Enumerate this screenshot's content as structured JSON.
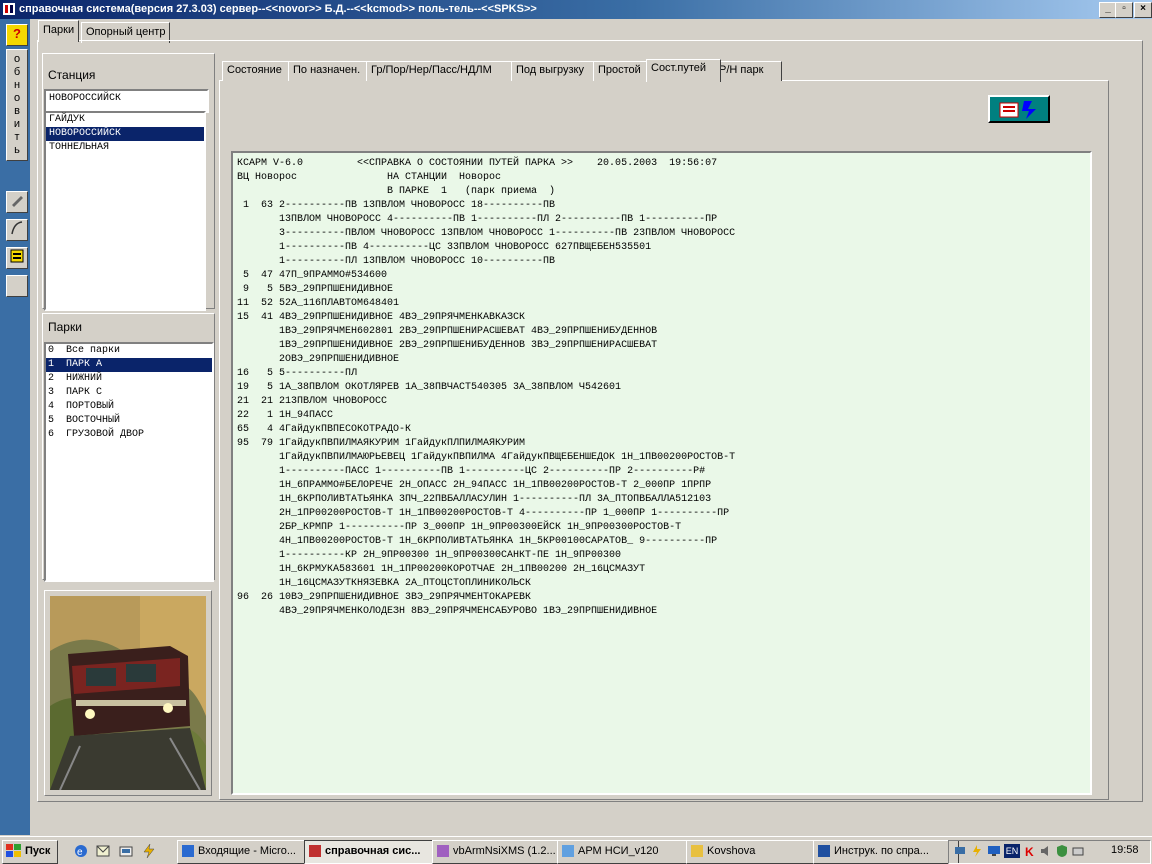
{
  "window": {
    "title": "справочная система(версия 27.3.03) сервер--<<novor>> Б.Д.--<<kcmod>> поль-тель--<<SPKS>>",
    "minimize": "_",
    "maximize": "▫",
    "close": "×"
  },
  "toolbar": {
    "help_label": "?",
    "refresh_letters": [
      "о",
      "б",
      "н",
      "о",
      "в",
      "и",
      "т",
      "ь"
    ]
  },
  "outer_tabs": [
    "Парки",
    "Опорный центр"
  ],
  "left": {
    "station_label": "Станция",
    "station_value": "НОВОРОССИЙСК",
    "stations": [
      "ГАЙДУК",
      "НОВОРОССИЙСК",
      "ТОННЕЛЬНАЯ"
    ],
    "stations_selected": 1,
    "parks_label": "Парки",
    "parks": [
      "0  Все парки",
      "1  ПАРК А",
      "2  НИЖНИЙ",
      "3  ПАРК С",
      "4  ПОРТОВЫЙ",
      "5  ВОСТОЧНЫЙ",
      "6  ГРУЗОВОЙ ДВОР"
    ],
    "parks_selected": 1
  },
  "inner_tabs": [
    "Состояние",
    "По назначен.",
    "Гр/Пор/Нер/Пасс/НДЛМ",
    "Под выгрузку",
    "Простой",
    "Сост.путей",
    "Р/Н парк"
  ],
  "inner_tab_active": 5,
  "report_lines": [
    "КСАРМ V-6.0         <<СПРАВКА О СОСТОЯНИИ ПУТЕЙ ПАРКА >>    20.05.2003  19:56:07",
    "ВЦ Новорос               НА СТАНЦИИ  Новорос",
    "                         В ПАРКЕ  1   (парк приема  )",
    " 1  63 2----------ПВ 13ПВЛОМ ЧНОВОРОСС 18----------ПВ",
    "       13ПВЛОМ ЧНОВОРОСС 4----------ПВ 1----------ПЛ 2----------ПВ 1----------ПР",
    "       3----------ПВЛОМ ЧНОВОРОСС 13ПВЛОМ ЧНОВОРОСС 1----------ПВ 23ПВЛОМ ЧНОВОРОСС",
    "       1----------ПВ 4----------ЦС 33ПВЛОМ ЧНОВОРОСС 627ПВЩЕБЕН535501",
    "       1----------ПЛ 13ПВЛОМ ЧНОВОРОСС 10----------ПВ",
    " 5  47 47П_9ПРАММО#534600",
    " 9   5 5ВЭ_29ПРПШЕНИДИВНОЕ",
    "11  52 52А_116ПЛАВТОМ648401",
    "15  41 4ВЭ_29ПРПШЕНИДИВНОЕ 4ВЭ_29ПРЯЧМЕНКАВКАЗСК",
    "       1ВЭ_29ПРЯЧМЕН602801 2ВЭ_29ПРПШЕНИРАСШЕВАТ 4ВЭ_29ПРПШЕНИБУДЕННОВ",
    "       1ВЭ_29ПРПШЕНИДИВНОЕ 2ВЭ_29ПРПШЕНИБУДЕННОВ 3ВЭ_29ПРПШЕНИРАСШЕВАТ",
    "       2ОВЭ_29ПРПШЕНИДИВНОЕ",
    "16   5 5----------ПЛ",
    "19   5 1А_38ПВЛОМ ОКОТЛЯРЕВ 1А_38ПВЧАСТ540305 3А_38ПВЛОМ Ч542601",
    "21  21 213ПВЛОМ ЧНОВОРОСС",
    "22   1 1Н_94ПАСС",
    "65   4 4ГайдукПВПЕСОКОТРАДО-К",
    "95  79 1ГайдукПВПИЛМАЯКУРИМ 1ГайдукПЛПИЛМАЯКУРИМ",
    "       1ГайдукПВПИЛМАЮРЬЕВЕЦ 1ГайдукПВПИЛМА 4ГайдукПВЩЕБЕНШЕДОК 1Н_1ПВ00200РОСТОВ-Т",
    "       1----------ПАСС 1----------ПВ 1----------ЦС 2----------ПР 2----------Р#",
    "       1Н_6ПРАММО#БЕЛОРЕЧЕ 2Н_ОПАСС 2Н_94ПАСС 1Н_1ПВ00200РОСТОВ-Т 2_000ПР 1ПРПР",
    "       1Н_6КРПОЛИВТАТЬЯНКА 3ПЧ_22ПВБАЛЛАСУЛИН 1----------ПЛ 3А_ПТОПВБАЛЛА512103",
    "       2Н_1ПР00200РОСТОВ-Т 1Н_1ПВ00200РОСТОВ-Т 4----------ПР 1_000ПР 1----------ПР",
    "       2БР_КРМПР 1----------ПР 3_000ПР 1Н_9ПР00300ЕЙСК 1Н_9ПР00300РОСТОВ-Т",
    "       4Н_1ПВ00200РОСТОВ-Т 1Н_6КРПОЛИВТАТЬЯНКА 1Н_5КР00100САРАТОВ_ 9----------ПР",
    "       1----------КР 2Н_9ПР00300 1Н_9ПР00300САНКТ-ПЕ 1Н_9ПР00300",
    "       1Н_6КРМУКА583601 1Н_1ПР00200КОРОТЧАЕ 2Н_1ПВ00200 2Н_16ЦСМАЗУТ",
    "       1Н_16ЦСМАЗУТКНЯЗЕВКА 2А_ПТОЦСТОПЛИНИКОЛЬСК",
    "96  26 10ВЭ_29ПРПШЕНИДИВНОЕ 3ВЭ_29ПРЯЧМЕНТОКАРЕВК",
    "       4ВЭ_29ПРЯЧМЕНКОЛОДЕЗН 8ВЭ_29ПРЯЧМЕНСАБУРОВО 1ВЭ_29ПРПШЕНИДИВНОЕ"
  ],
  "taskbar": {
    "start": "Пуск",
    "buttons": [
      "Входящие - Micro...",
      "справочная сис...",
      "vbArmNsiXMS (1.2...",
      "АРМ НСИ_v120",
      "Kovshova",
      "Инструк. по спра..."
    ],
    "active": 1,
    "clock": "19:58",
    "lang": "EN"
  },
  "colors": {
    "face": "#d4d0c8",
    "title": "#0a246a",
    "report_bg": "#eaf8e8",
    "selection": "#0a246a",
    "sidebar": "#3a6ea5"
  }
}
